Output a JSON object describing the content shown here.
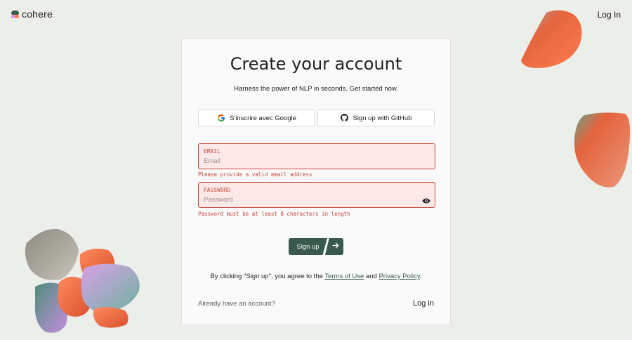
{
  "brand": {
    "name": "cohere"
  },
  "header": {
    "login_label": "Log In"
  },
  "card": {
    "title": "Create your account",
    "subtitle": "Harness the power of NLP in seconds. Get started now.",
    "google_label": "S'inscrire avec Google",
    "github_label": "Sign up with GitHub",
    "email": {
      "label": "EMAIL",
      "placeholder": "Email",
      "value": "",
      "error": "Please provide a valid email address"
    },
    "password": {
      "label": "PASSWORD",
      "placeholder": "Password",
      "value": "",
      "error": "Password must be at least 8 characters in length"
    },
    "signup_label": "Sign up",
    "terms": {
      "prefix": "By clicking \"Sign up\", you agree to the ",
      "terms_link": "Terms of Use",
      "middle": " and ",
      "privacy_link": "Privacy Policy",
      "suffix": "."
    },
    "already_text": "Already have an account?",
    "login_label": "Log in"
  },
  "icons": {
    "google": "google-icon",
    "github": "github-icon",
    "eye": "eye-icon",
    "arrow": "arrow-right-icon"
  },
  "colors": {
    "accent": "#39594d",
    "error": "#c7453c",
    "error_bg": "#fdeae8",
    "background": "#eceeea",
    "card": "#fafafa",
    "coral": "#ff7759",
    "lilac": "#d18ee2"
  }
}
